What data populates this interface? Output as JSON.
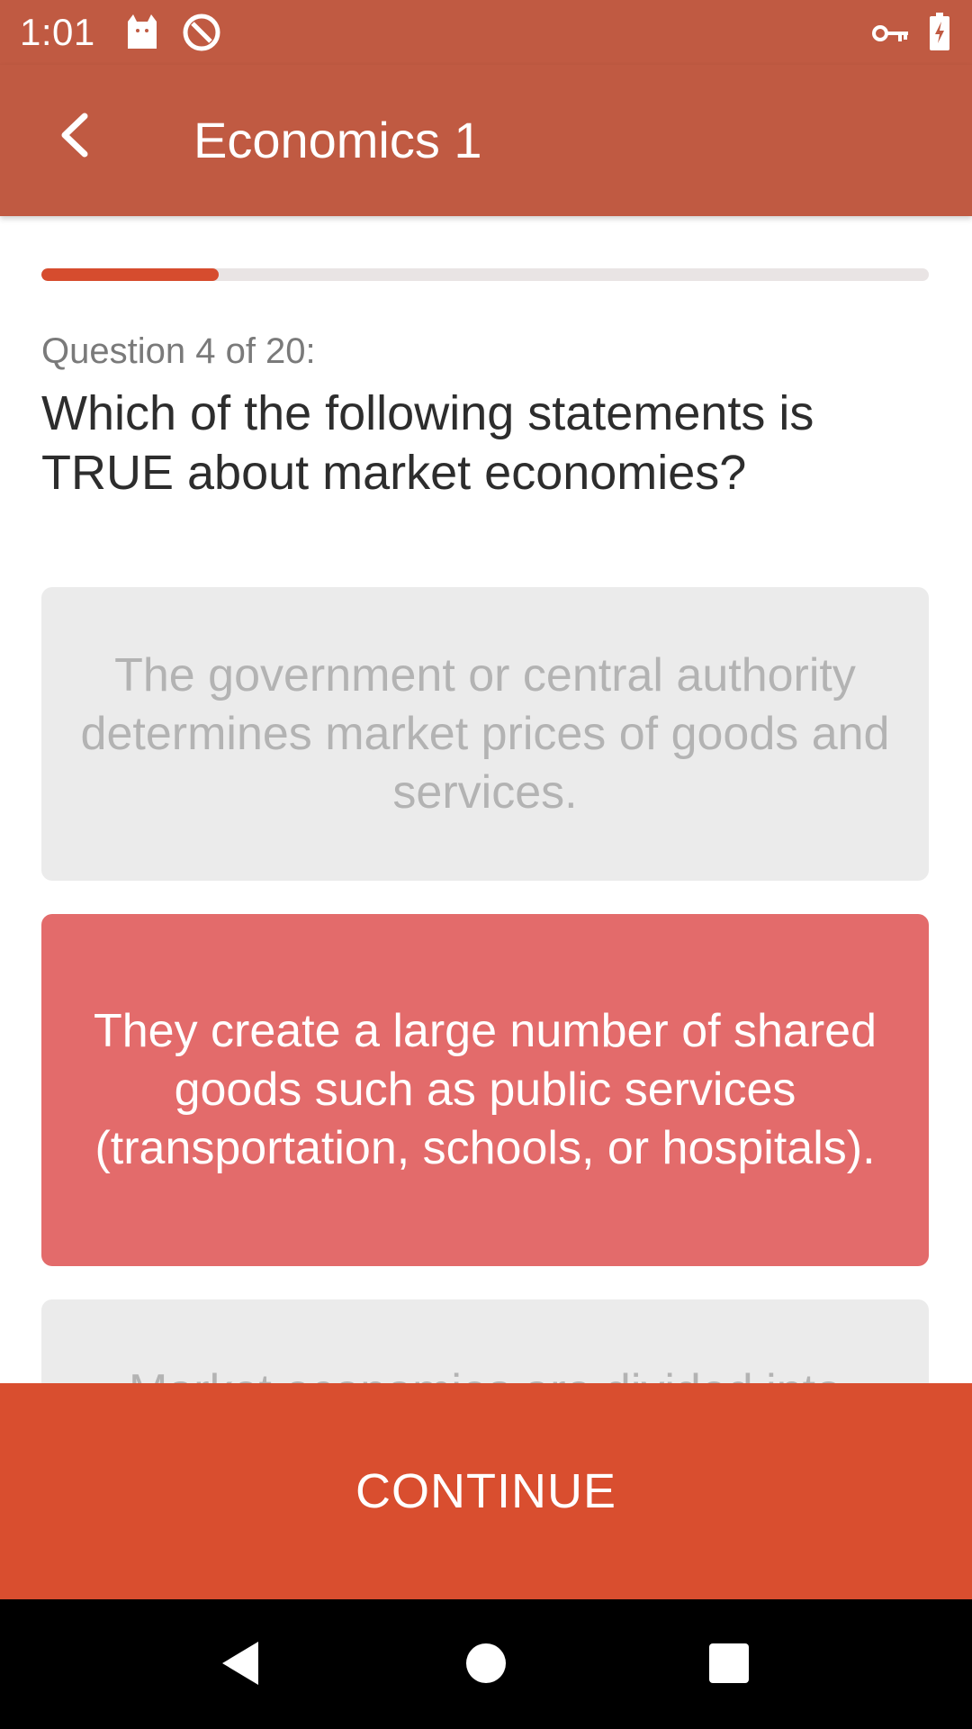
{
  "status_bar": {
    "time": "1:01",
    "icons": [
      "cat-notification-icon",
      "blocked-circle-icon",
      "vpn-key-icon",
      "battery-charging-icon"
    ]
  },
  "app_bar": {
    "back_icon": "chevron-left-icon",
    "title": "Economics 1"
  },
  "progress": {
    "fraction": 0.2,
    "color": "#d64c2e"
  },
  "question": {
    "counter": "Question 4 of 20:",
    "text": "Which of the following statements is TRUE about market economies?"
  },
  "answers": [
    {
      "text": "The government or central authority determines market prices of goods and services.",
      "state": "disabled"
    },
    {
      "text": "They create a large number of shared goods such as public services (transportation, schools, or hospitals).",
      "state": "wrong"
    },
    {
      "text": "Market economies are divided into",
      "state": "disabled"
    }
  ],
  "continue_label": "CONTINUE",
  "nav_bar": {
    "icons": [
      "back-triangle-icon",
      "home-circle-icon",
      "recents-square-icon"
    ]
  },
  "colors": {
    "app_bar": "#c05a42",
    "continue": "#d94e2f",
    "wrong_answer": "#e36b6b",
    "disabled_answer": "#ebebeb"
  }
}
